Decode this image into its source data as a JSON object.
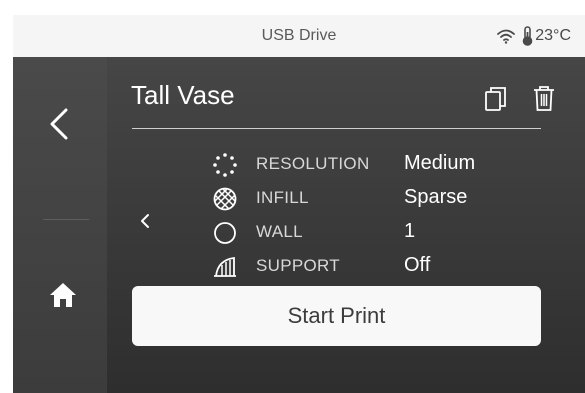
{
  "status_bar": {
    "title": "USB Drive",
    "temperature": "23°C",
    "wifi_icon": "wifi-icon",
    "thermometer_icon": "thermometer-icon"
  },
  "sidebar": {
    "back_icon": "chevron-left-icon",
    "home_icon": "home-icon"
  },
  "header": {
    "title": "Tall Vase",
    "copy_icon": "copy-icon",
    "delete_icon": "trash-icon"
  },
  "settings": [
    {
      "icon": "resolution-dots-icon",
      "label": "RESOLUTION",
      "value": "Medium"
    },
    {
      "icon": "infill-pattern-icon",
      "label": "INFILL",
      "value": "Sparse"
    },
    {
      "icon": "wall-circle-icon",
      "label": "WALL",
      "value": "1"
    },
    {
      "icon": "support-structure-icon",
      "label": "SUPPORT",
      "value": "Off"
    }
  ],
  "actions": {
    "start_print_label": "Start Print",
    "prev_icon": "chevron-left-small-icon"
  },
  "colors": {
    "status_bar_bg": "#f5f5f5",
    "panel_bg": "#3c3c3c",
    "button_bg": "#f8f8f8",
    "text_light": "#ffffff"
  }
}
